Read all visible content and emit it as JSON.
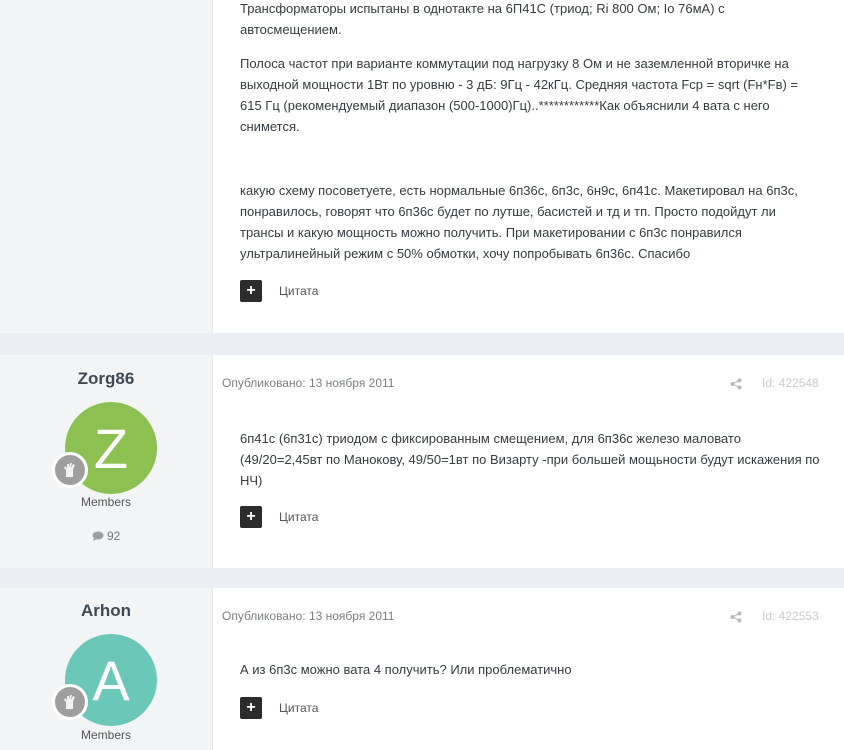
{
  "post1": {
    "paragraphs": [
      "Трансформаторы испытаны в однотакте на 6П41С (триод; Ri 800 Ом; Io 76мА) с автосмещением.",
      "Полоса частот при варианте коммутации под нагрузку 8 Ом и не заземленной вторичке на выходной мощности 1Вт по уровню - 3 дБ: 9Гц - 42кГц. Средняя частота Fср = sqrt (Fн*Fв) = 615 Гц (рекомендуемый диапазон (500-1000)Гц)..************Как объяснили 4 вата с него снимется.",
      "какую схему посоветуете, есть нормальные 6п36с, 6п3с, 6н9с, 6п41с. Макетировал на 6п3с, понравилось, говорят что 6п36с будет по лутше, басистей и тд и тп. Просто подойдут ли трансы и какую мощность можно получить. При макетировании с 6п3с понравился ультралинейный режим с 50% обмотки, хочу попробывать 6п36с. Спасибо"
    ],
    "quote_label": "Цитата"
  },
  "post2": {
    "author": "Zorg86",
    "avatar_letter": "Z",
    "avatar_color": "#8cc152",
    "group": "Members",
    "post_count": "92",
    "published": "Опубликовано: 13 ноября 2011",
    "post_id": "Id: 422548",
    "text": "6п41с (6п31с) триодом с фиксированным смещением, для 6п36с железо маловато (49/20=2,45вт по Манокову, 49/50=1вт по Визарту -при большей мощьности будут искажения по НЧ)",
    "quote_label": "Цитата"
  },
  "post3": {
    "author": "Arhon",
    "avatar_letter": "A",
    "avatar_color": "#6bc8b8",
    "group": "Members",
    "published": "Опубликовано: 13 ноября 2011",
    "post_id": "Id: 422553",
    "text": "А из 6п3с можно вата 4 получить? Или проблематично",
    "quote_label": "Цитата"
  }
}
